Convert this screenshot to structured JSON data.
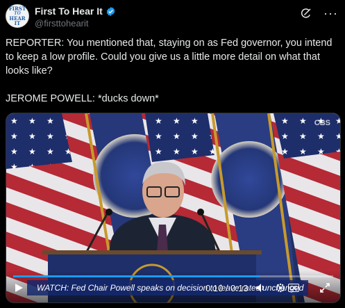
{
  "account": {
    "display_name": "First To Hear It",
    "handle": "@firsttohearit",
    "avatar_lines": [
      "FIRST",
      "TO",
      "HEAR",
      "IT"
    ],
    "verified_color": "#1d9bf0"
  },
  "post": {
    "line1": "REPORTER: You mentioned that, staying on as Fed governor, you intend to keep a low profile. Could you give us a little more detail on what that looks like?",
    "line2": "JEROME POWELL: *ducks down*"
  },
  "video": {
    "chyron": "WATCH: Fed Chair Powell speaks on decision to leave rates unchanged",
    "timecode": "0:10 / 0:13",
    "progress": 0.77,
    "channel_logo": "CBS",
    "icons": [
      "play-icon",
      "volume-icon",
      "settings-icon",
      "captions-icon",
      "expand-icon"
    ],
    "cc_label": "CC"
  },
  "colors": {
    "background": "#000000",
    "text": "#e7e9ea",
    "secondary": "#71767b",
    "accent": "#1d9bf0"
  }
}
